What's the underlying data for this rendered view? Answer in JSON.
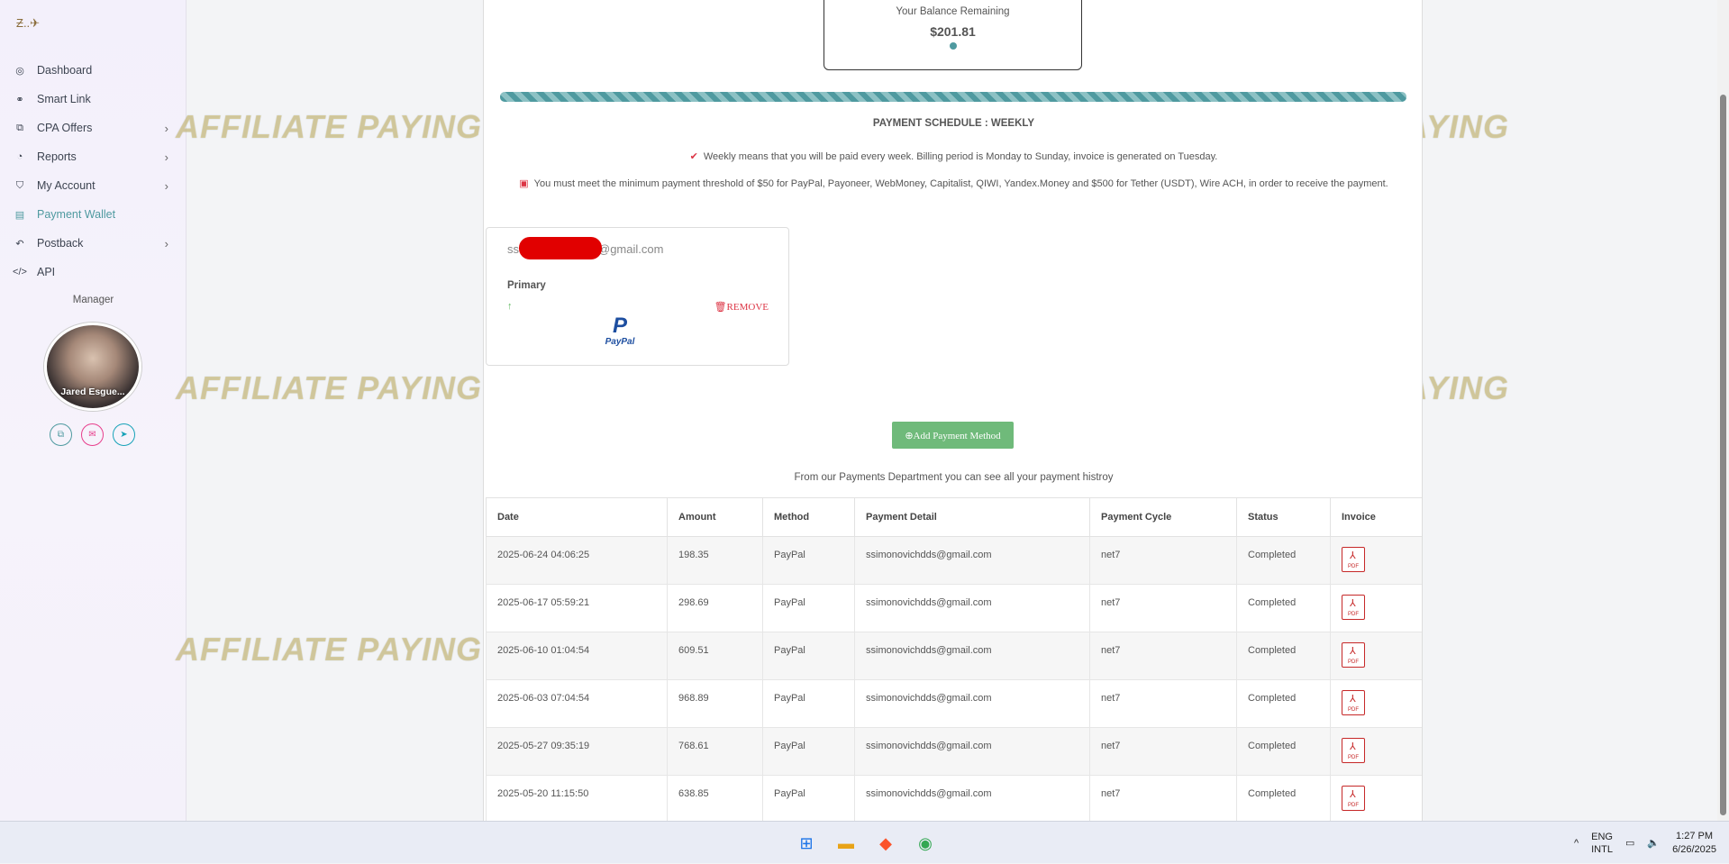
{
  "sidebar": {
    "logo_text": "Ƶ..✈",
    "items": [
      {
        "label": "Dashboard",
        "icon": "dashboard-icon",
        "glyph": "◎",
        "chevron": ""
      },
      {
        "label": "Smart Link",
        "icon": "link-icon",
        "glyph": "⚭",
        "chevron": ""
      },
      {
        "label": "CPA Offers",
        "icon": "tag-icon",
        "glyph": "⧉",
        "chevron": "›"
      },
      {
        "label": "Reports",
        "icon": "pie-chart-icon",
        "glyph": "◔",
        "chevron": "›"
      },
      {
        "label": "My Account",
        "icon": "shield-icon",
        "glyph": "⛉",
        "chevron": "›"
      },
      {
        "label": "Payment Wallet",
        "icon": "wallet-icon",
        "glyph": "▤",
        "chevron": ""
      },
      {
        "label": "Postback",
        "icon": "undo-icon",
        "glyph": "↶",
        "chevron": "›"
      },
      {
        "label": "API",
        "icon": "code-icon",
        "glyph": "</>",
        "chevron": ""
      }
    ],
    "manager_label": "Manager",
    "manager_name": "Jared Esgue..."
  },
  "balance": {
    "label": "Your Balance Remaining",
    "value": "$201.81"
  },
  "schedule": {
    "title": "PAYMENT SCHEDULE : WEEKLY",
    "line1": "Weekly means that you will be paid every week. Billing period is Monday to Sunday, invoice is generated on Tuesday.",
    "line2": "You must meet the minimum payment threshold of $50 for PayPal, Payoneer, WebMoney, Capitalist, QIWI, Yandex.Money and $500 for Tether (USDT), Wire ACH, in order to receive the payment."
  },
  "payment_method": {
    "email_prefix": "ss",
    "email_suffix": "@gmail.com",
    "primary_label": "Primary",
    "remove_label": "🗑REMOVE",
    "paypal_label": "PayPal"
  },
  "add_button": "⊕Add Payment Method",
  "history_note": "From our Payments Department you can see all your payment histroy",
  "table": {
    "headers": [
      "Date",
      "Amount",
      "Method",
      "Payment Detail",
      "Payment Cycle",
      "Status",
      "Invoice"
    ],
    "rows": [
      [
        "2025-06-24 04:06:25",
        "198.35",
        "PayPal",
        "ssimonovichdds@gmail.com",
        "net7",
        "Completed"
      ],
      [
        "2025-06-17 05:59:21",
        "298.69",
        "PayPal",
        "ssimonovichdds@gmail.com",
        "net7",
        "Completed"
      ],
      [
        "2025-06-10 01:04:54",
        "609.51",
        "PayPal",
        "ssimonovichdds@gmail.com",
        "net7",
        "Completed"
      ],
      [
        "2025-06-03 07:04:54",
        "968.89",
        "PayPal",
        "ssimonovichdds@gmail.com",
        "net7",
        "Completed"
      ],
      [
        "2025-05-27 09:35:19",
        "768.61",
        "PayPal",
        "ssimonovichdds@gmail.com",
        "net7",
        "Completed"
      ],
      [
        "2025-05-20 11:15:50",
        "638.85",
        "PayPal",
        "ssimonovichdds@gmail.com",
        "net7",
        "Completed"
      ]
    ]
  },
  "watermark": "AFFILIATE PAYING",
  "taskbar": {
    "lang_top": "ENG",
    "lang_bottom": "INTL",
    "time": "1:27 PM",
    "date": "6/26/2025"
  },
  "colors": {
    "accent": "#4f9aa0",
    "button": "#6fba7a",
    "danger": "#dc3545"
  }
}
